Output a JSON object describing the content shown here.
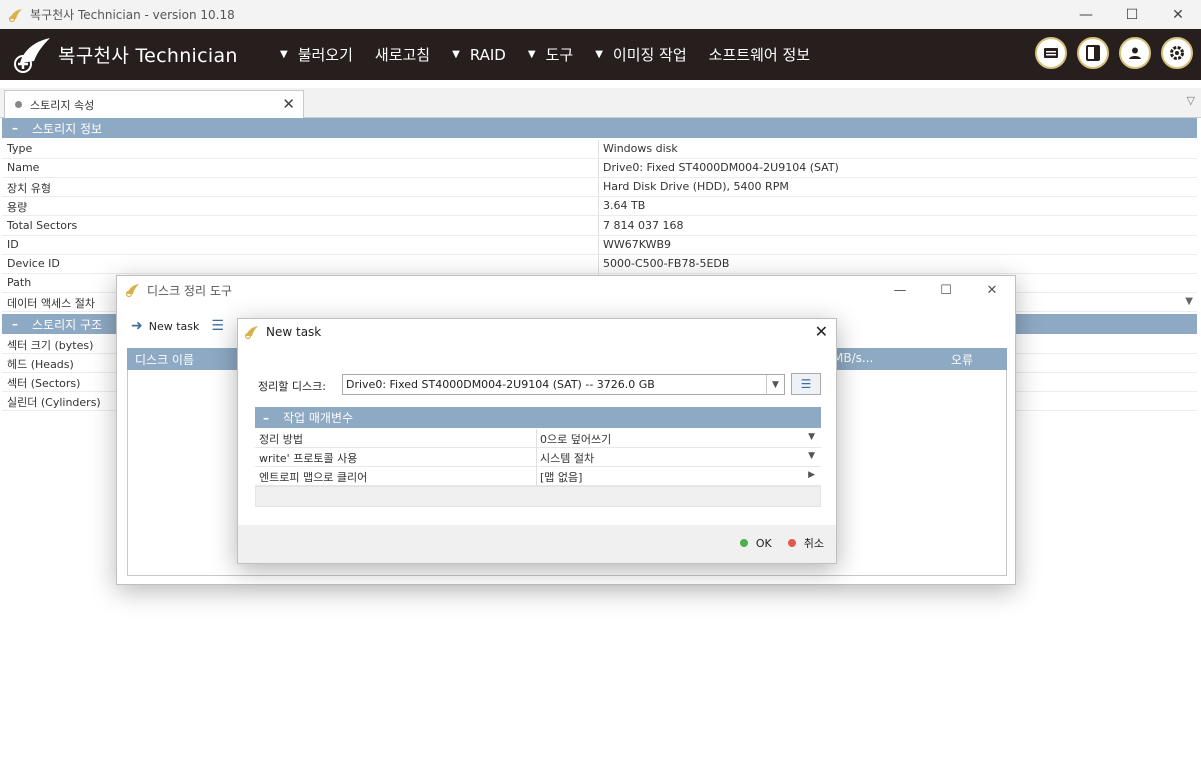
{
  "window": {
    "title": "복구천사 Technician - version 10.18"
  },
  "menubar": {
    "brand": "복구천사 Technician",
    "items": [
      {
        "label": "불러오기",
        "has_caret": true
      },
      {
        "label": "새로고침",
        "has_caret": false
      },
      {
        "label": "RAID",
        "has_caret": true
      },
      {
        "label": "도구",
        "has_caret": true
      },
      {
        "label": "이미징 작업",
        "has_caret": true
      },
      {
        "label": "소프트웨어 정보",
        "has_caret": false
      }
    ],
    "icons": [
      "card-icon",
      "panel-icon",
      "user-icon",
      "gear-icon"
    ],
    "caret": "▼"
  },
  "tab": {
    "label": "스토리지 속성"
  },
  "storage_info": {
    "header": "스토리지 정보",
    "toggle": "–",
    "rows": [
      {
        "key": "Type",
        "value": "Windows disk"
      },
      {
        "key": "Name",
        "value": "Drive0: Fixed ST4000DM004-2U9104 (SAT)"
      },
      {
        "key": "장치 유형",
        "value": "Hard Disk Drive (HDD), 5400 RPM"
      },
      {
        "key": "용량",
        "value": "3.64 TB"
      },
      {
        "key": "Total Sectors",
        "value": "7 814 037 168"
      },
      {
        "key": "ID",
        "value": "WW67KWB9"
      },
      {
        "key": "Device ID",
        "value": "5000-C500-FB78-5EDB"
      },
      {
        "key": "Path",
        "value": ""
      },
      {
        "key": "데이터 액세스 절차",
        "value": ""
      }
    ]
  },
  "storage_structure": {
    "header": "스토리지 구조",
    "toggle": "–",
    "rows": [
      {
        "key": "섹터 크기 (bytes)"
      },
      {
        "key": "헤드 (Heads)"
      },
      {
        "key": "섹터 (Sectors)"
      },
      {
        "key": "실린더 (Cylinders)"
      }
    ]
  },
  "cleanup_dialog": {
    "title": "디스크 정리 도구",
    "toolbar": {
      "new_task": "New task"
    },
    "columns": {
      "disk_name": "디스크 이름",
      "speed": "MB/s...",
      "errors": "오류"
    }
  },
  "new_task_dialog": {
    "title": "New task",
    "disk_label": "정리할 디스크:",
    "disk_value": "Drive0: Fixed ST4000DM004-2U9104 (SAT) -- 3726.0 GB",
    "params_header": "작업 매개변수",
    "params": [
      {
        "key": "정리 방법",
        "value": "0으로 덮어쓰기",
        "arrow": "▼"
      },
      {
        "key": "write' 프로토콜 사용",
        "value": "시스템 절차",
        "arrow": "▼"
      },
      {
        "key": "엔트로피 맵으로 클리어",
        "value": "[맵 없음]",
        "arrow": "▶"
      }
    ],
    "ok_label": "OK",
    "cancel_label": "취소",
    "ok_color": "#4caf50",
    "cancel_color": "#e05a4f"
  },
  "colors": {
    "menubar_bg": "#261f1e",
    "section_header": "#8ea9c3",
    "icon_ring": "#d8c07a"
  }
}
